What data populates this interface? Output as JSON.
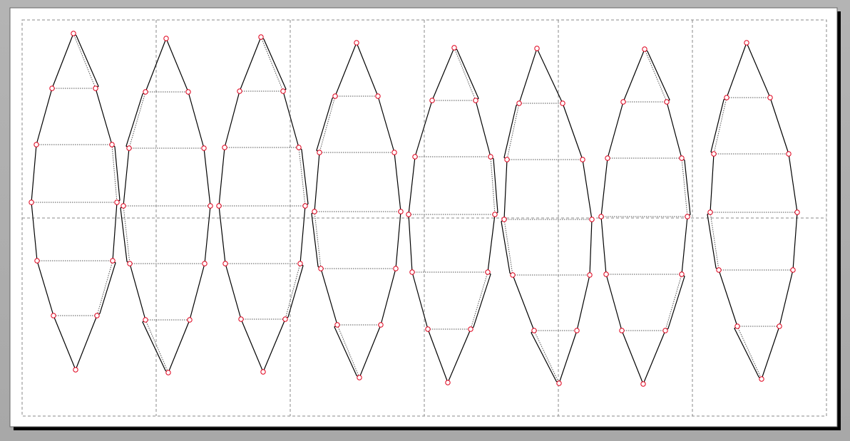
{
  "app": {
    "view": "pattern-layout"
  },
  "colors": {
    "background": "#aaaaaa",
    "sheet": "#ffffff",
    "sheet_shadow": "#000000",
    "outline": "#000000",
    "seam": "#555555",
    "grid": "#888888",
    "vertex": "#e0001b"
  },
  "sheet": {
    "columns": 6,
    "rows": 1,
    "vertex_marker": "circle-handle"
  },
  "gores": {
    "count": 8,
    "rungs_per_gore": 6,
    "tabs": "glue-flaps-shown"
  }
}
